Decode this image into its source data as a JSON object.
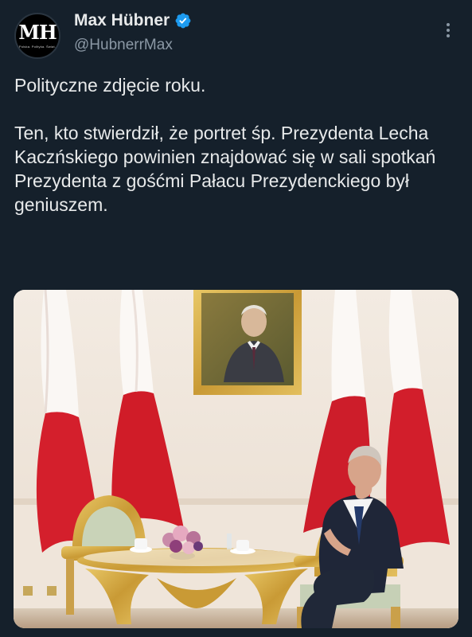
{
  "tweet": {
    "author_name": "Max Hübner",
    "author_handle": "@HubnerrMax",
    "avatar": {
      "initials": "MH",
      "tagline": "Polska. Polityka. Świat."
    },
    "verified_icon": "verified-badge-icon",
    "more_icon": "more-options-icon",
    "text": "Polityczne zdjęcie roku.\n\nTen, kto stwierdził, że portret śp. Prezydenta Lecha Kaczńskiego powinien znajdować się w sali spotkań Prezydenta z gośćmi Pałacu Prezydenckiego był geniuszem."
  },
  "colors": {
    "background": "#15202b",
    "text": "#e7e9ea",
    "secondary_text": "#8b98a5",
    "verified": "#1d9bf0"
  }
}
